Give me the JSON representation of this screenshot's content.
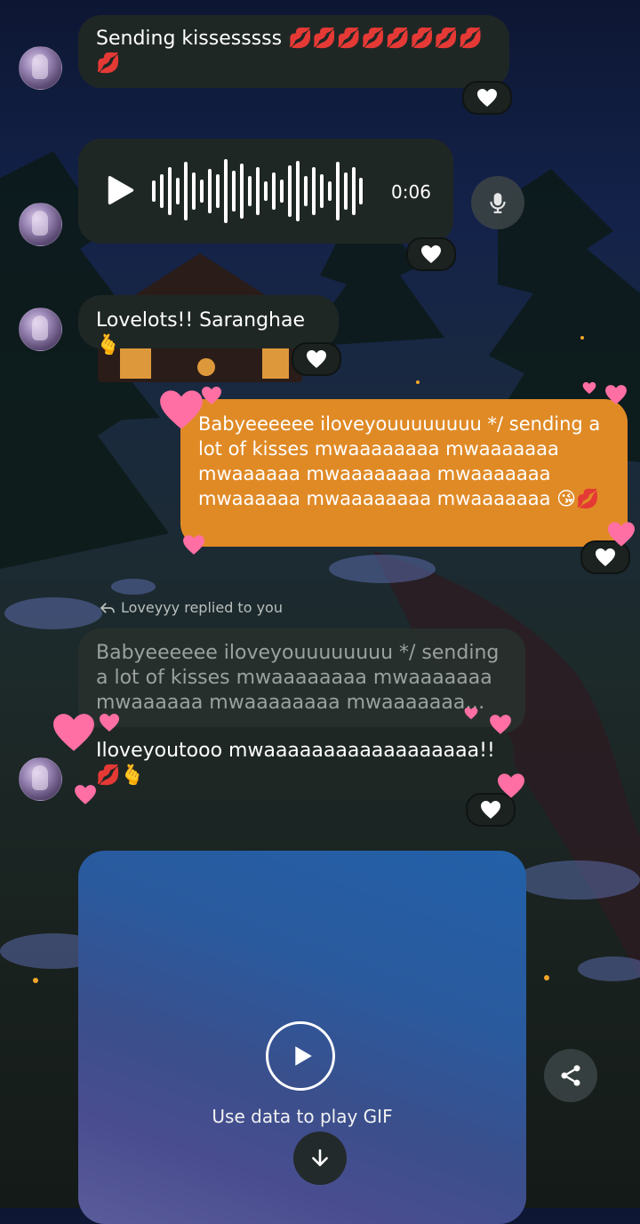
{
  "messages": [
    {
      "id": "m1",
      "text": "Sending kissesssss 💋💋💋💋💋💋💋💋💋",
      "reaction": "heart-icon"
    },
    {
      "id": "m2",
      "type": "voice",
      "duration": "0:06",
      "reaction": "heart-icon"
    },
    {
      "id": "m3",
      "text": "Lovelots!! Saranghae🫰",
      "reaction": "heart-icon"
    },
    {
      "id": "m4",
      "mine": true,
      "text": "Babyeeeeee iloveyouuuuuuuu */ sending a lot of kisses mwaaaaaaaa mwaaaaaaa mwaaaaaa mwaaaaaaaa mwaaaaaaa mwaaaaaa mwaaaaaaaa mwaaaaaaa 😘💋",
      "reaction": "heart-icon"
    },
    {
      "id": "m5",
      "reply_label": "Loveyyy replied to you",
      "quoted": "Babyeeeeee iloveyouuuuuuuu */ sending a lot of kisses mwaaaaaaaa mwaaaaaaa mwaaaaaa mwaaaaaaaa mwaaaaaaa…",
      "text": "Iloveyoutooo mwaaaaaaaaaaaaaaaaaa!! 💋🫰",
      "reaction": "heart-icon"
    },
    {
      "id": "m6",
      "type": "gif",
      "gif_label": "Use data to play GIF"
    }
  ],
  "colors": {
    "mine": "#e08a26",
    "theirs": "#1f2725",
    "heart": "#ff6fa3"
  },
  "icons": {
    "voice": "microphone-icon",
    "share": "share-icon",
    "play": "play-icon",
    "download": "arrow-down-icon"
  }
}
